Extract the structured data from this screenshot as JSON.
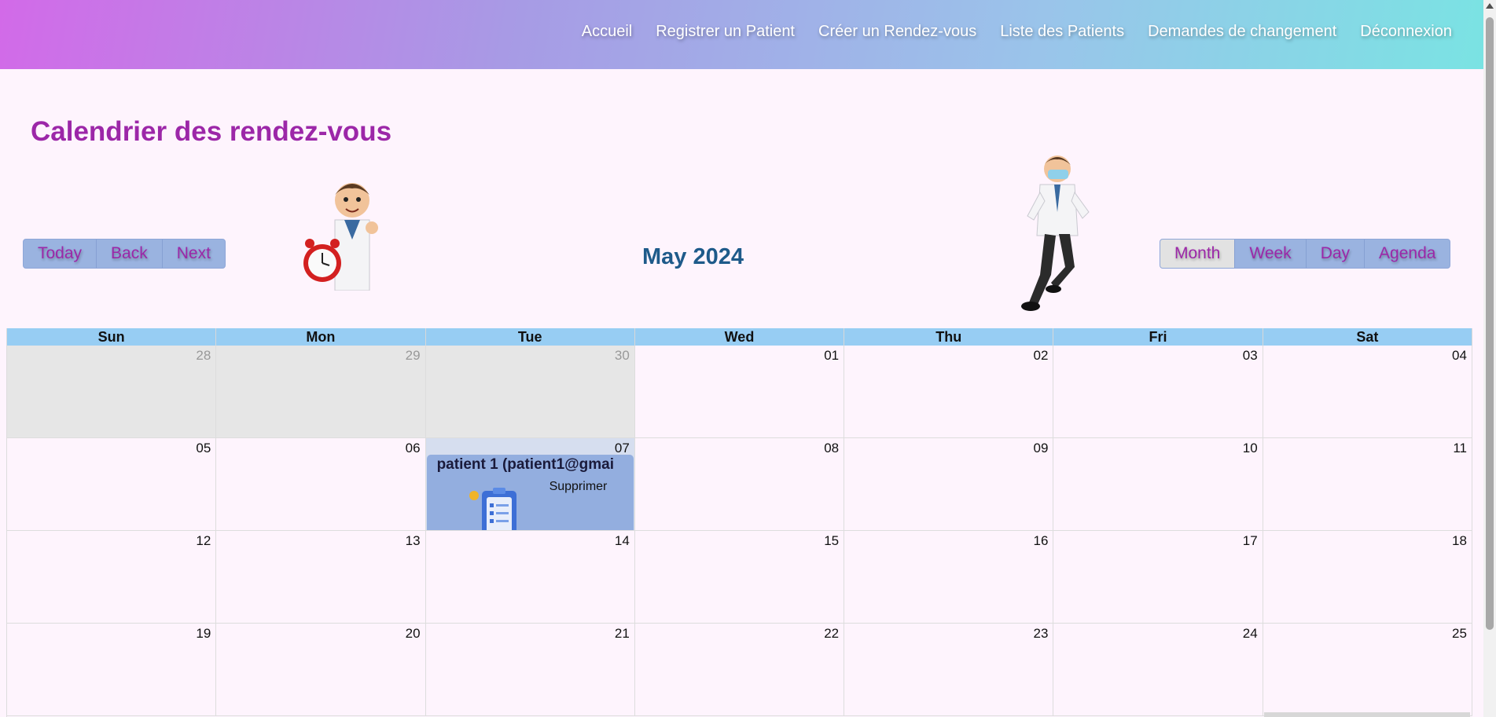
{
  "nav": {
    "items": [
      {
        "label": "Accueil"
      },
      {
        "label": "Registrer un Patient"
      },
      {
        "label": "Créer un Rendez-vous"
      },
      {
        "label": "Liste des Patients"
      },
      {
        "label": "Demandes de changement"
      },
      {
        "label": "Déconnexion"
      }
    ]
  },
  "page": {
    "title": "Calendrier des rendez-vous"
  },
  "toolbar": {
    "nav_buttons": [
      {
        "label": "Today"
      },
      {
        "label": "Back"
      },
      {
        "label": "Next"
      }
    ],
    "month_label": "May 2024",
    "views": [
      {
        "label": "Month",
        "active": true
      },
      {
        "label": "Week"
      },
      {
        "label": "Day"
      },
      {
        "label": "Agenda"
      }
    ]
  },
  "calendar": {
    "weekdays": [
      "Sun",
      "Mon",
      "Tue",
      "Wed",
      "Thu",
      "Fri",
      "Sat"
    ],
    "weeks": [
      [
        "28",
        "29",
        "30",
        "01",
        "02",
        "03",
        "04"
      ],
      [
        "05",
        "06",
        "07",
        "08",
        "09",
        "10",
        "11"
      ],
      [
        "12",
        "13",
        "14",
        "15",
        "16",
        "17",
        "18"
      ],
      [
        "19",
        "20",
        "21",
        "22",
        "23",
        "24",
        "25"
      ]
    ],
    "event": {
      "title": "patient 1 (patient1@gmai",
      "action": "Supprimer"
    }
  },
  "colors": {
    "accent": "#9c27a8",
    "month_label": "#1e5a8a",
    "header_row": "#97cdf3",
    "event_bg": "#93aedf"
  }
}
